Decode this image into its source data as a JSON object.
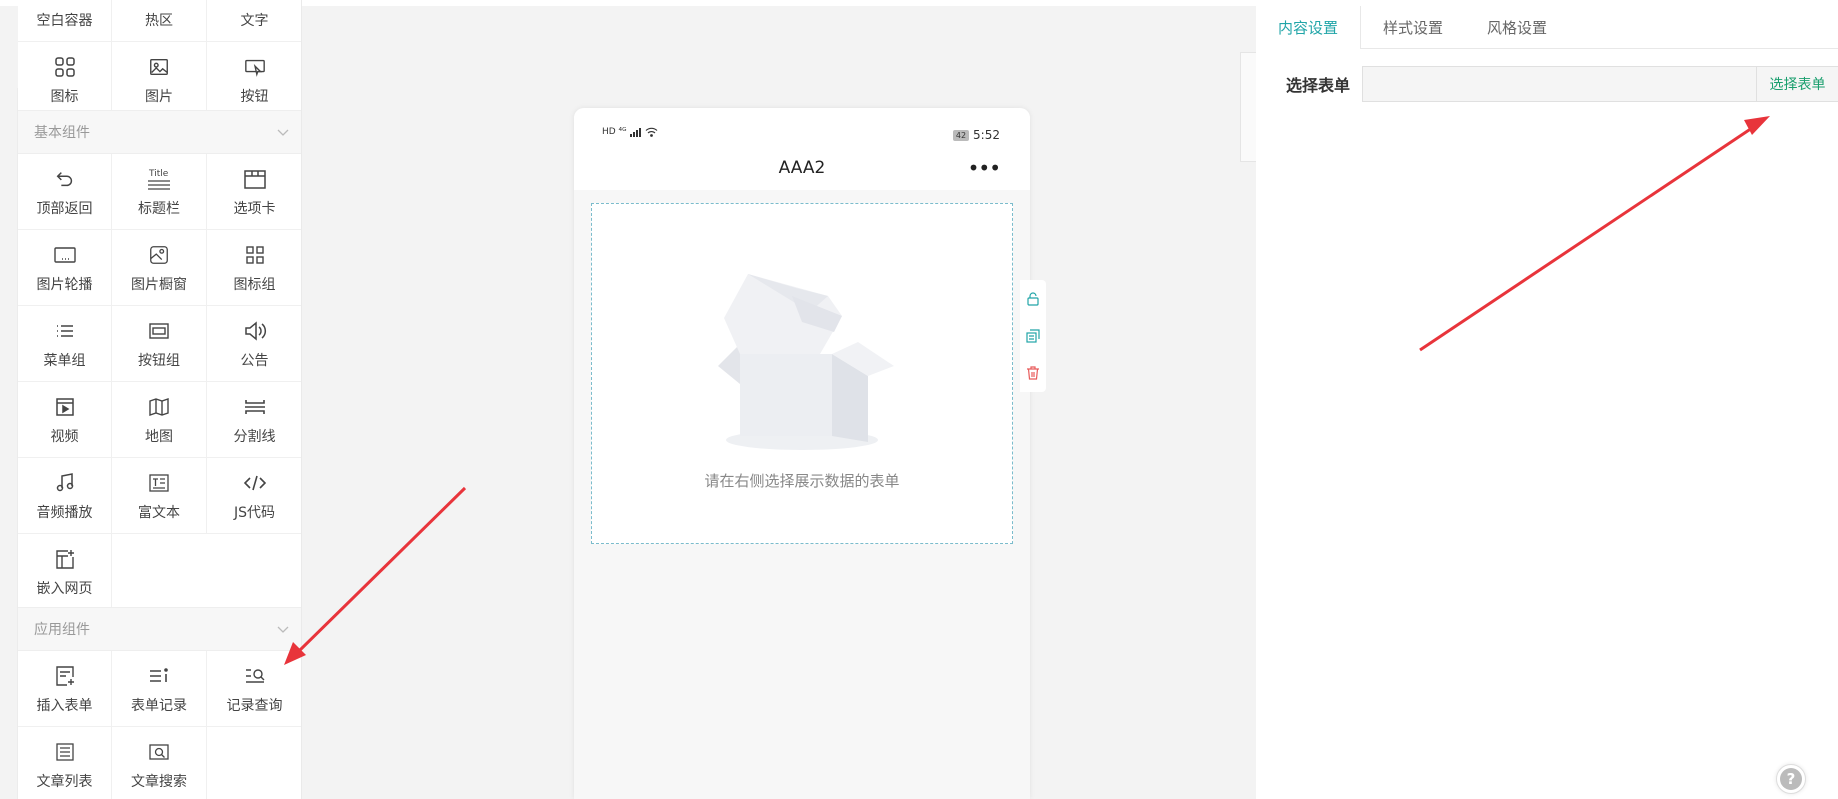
{
  "left_panel": {
    "top_items": [
      {
        "label": "空白容器",
        "icon": "blank-container-icon"
      },
      {
        "label": "热区",
        "icon": "hotspot-icon"
      },
      {
        "label": "文字",
        "icon": "text-icon"
      },
      {
        "label": "图标",
        "icon": "icon-grid-icon"
      },
      {
        "label": "图片",
        "icon": "image-icon"
      },
      {
        "label": "按钮",
        "icon": "button-icon"
      }
    ],
    "basic_section_title": "基本组件",
    "basic_items": [
      {
        "label": "顶部返回",
        "icon": "back-icon"
      },
      {
        "label": "标题栏",
        "icon": "title-bar-icon"
      },
      {
        "label": "选项卡",
        "icon": "tab-card-icon"
      },
      {
        "label": "图片轮播",
        "icon": "carousel-icon"
      },
      {
        "label": "图片橱窗",
        "icon": "image-window-icon"
      },
      {
        "label": "图标组",
        "icon": "icon-group-icon"
      },
      {
        "label": "菜单组",
        "icon": "menu-list-icon"
      },
      {
        "label": "按钮组",
        "icon": "button-group-icon"
      },
      {
        "label": "公告",
        "icon": "speaker-icon"
      },
      {
        "label": "视频",
        "icon": "video-icon"
      },
      {
        "label": "地图",
        "icon": "map-icon"
      },
      {
        "label": "分割线",
        "icon": "divider-icon"
      },
      {
        "label": "音频播放",
        "icon": "music-icon"
      },
      {
        "label": "富文本",
        "icon": "rich-text-icon"
      },
      {
        "label": "JS代码",
        "icon": "code-icon"
      },
      {
        "label": "嵌入网页",
        "icon": "embed-page-icon"
      }
    ],
    "app_section_title": "应用组件",
    "app_items": [
      {
        "label": "插入表单",
        "icon": "insert-form-icon"
      },
      {
        "label": "表单记录",
        "icon": "form-record-icon"
      },
      {
        "label": "记录查询",
        "icon": "record-search-icon"
      },
      {
        "label": "文章列表",
        "icon": "article-list-icon"
      },
      {
        "label": "文章搜索",
        "icon": "article-search-icon"
      }
    ]
  },
  "phone": {
    "status_left": "HD ⁴ᴳ",
    "battery": "42",
    "time": "5:52",
    "title": "AAA2",
    "more": "•••",
    "empty_text": "请在右侧选择展示数据的表单"
  },
  "right_panel": {
    "tabs": [
      "内容设置",
      "样式设置",
      "风格设置"
    ],
    "active_tab": "内容设置",
    "field_label": "选择表单",
    "field_value": "",
    "select_button": "选择表单"
  },
  "help_label": "?",
  "colors": {
    "accent": "#21a5a8",
    "select_button": "#1a9f6e",
    "arrow": "#e8343b",
    "delete": "#e85a5a"
  }
}
